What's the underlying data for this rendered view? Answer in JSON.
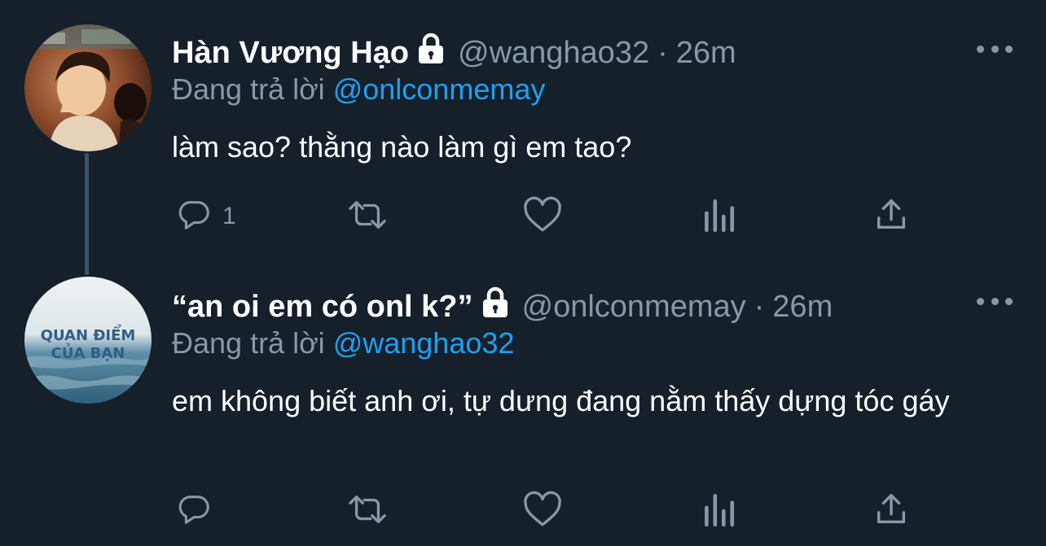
{
  "tweets": [
    {
      "name": "Hàn Vương Hạo",
      "handle": "@wanghao32",
      "separator": "·",
      "time": "26m",
      "reply_prefix": "Đang trả lời",
      "reply_to": "@onlconmemay",
      "text": "làm sao? thằng nào làm gì em tao?",
      "reply_count": "1",
      "avatar_icon": "user-photo-avatar"
    },
    {
      "name": "“an oi em có onl k?”",
      "handle": "@onlconmemay",
      "separator": "·",
      "time": "26m",
      "reply_prefix": "Đang trả lời",
      "reply_to": "@wanghao32",
      "text": "em không biết anh ơi, tự dưng đang nằm thấy dựng tóc gáy",
      "reply_count": "",
      "avatar_icon": "album-cover-avatar",
      "avatar_text": {
        "line1": "QUAN ĐIỂM",
        "line2": "CỦA BẠN"
      }
    }
  ],
  "icons": {
    "lock": "lock-icon",
    "more": "more-icon",
    "reply": "reply-icon",
    "retweet": "retweet-icon",
    "like": "like-icon",
    "analytics": "analytics-icon",
    "share": "share-icon"
  },
  "colors": {
    "background": "#15202b",
    "primary_text": "#ffffff",
    "secondary_text": "#8899a6",
    "link": "#1da1f2",
    "thread_line": "#3d5466"
  }
}
